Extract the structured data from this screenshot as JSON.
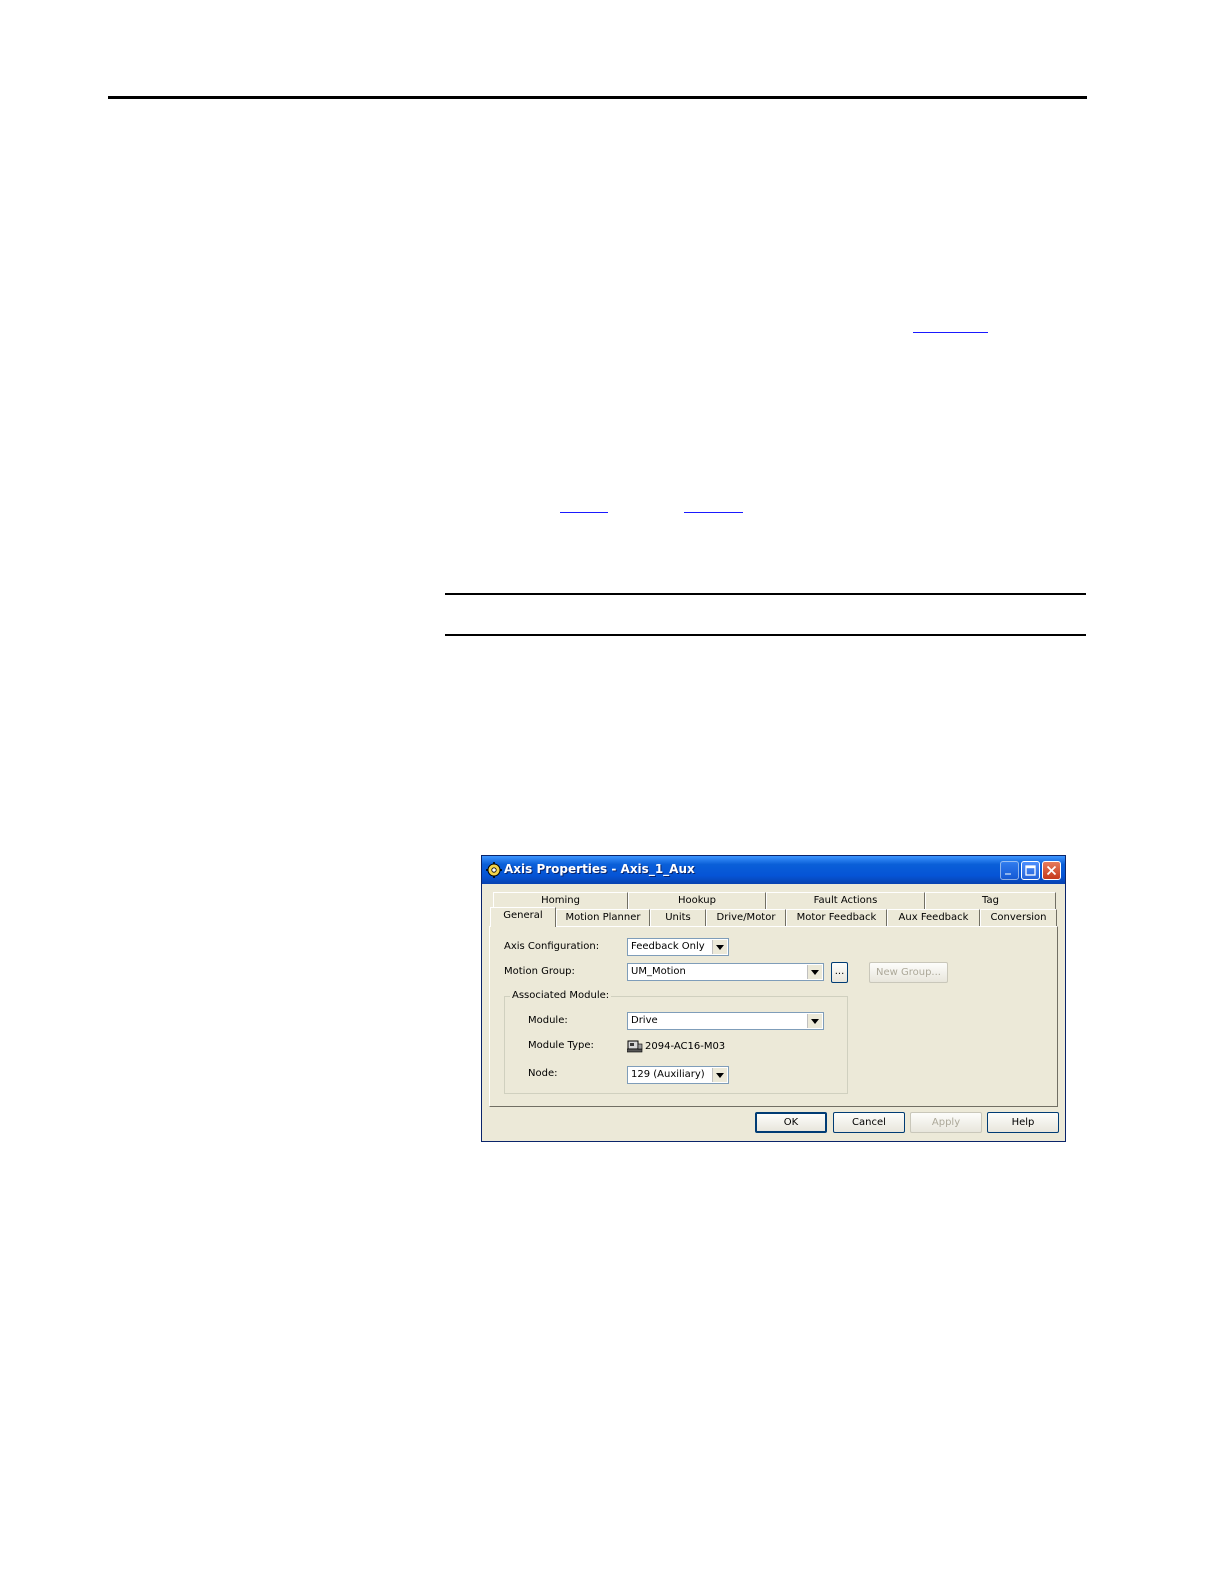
{
  "dialog": {
    "title": "Axis Properties - Axis_1_Aux",
    "tabs_back": [
      "Homing",
      "Hookup",
      "Fault Actions",
      "Tag"
    ],
    "tabs_front": [
      "General",
      "Motion Planner",
      "Units",
      "Drive/Motor",
      "Motor Feedback",
      "Aux Feedback",
      "Conversion"
    ],
    "active_tab": "General",
    "fields": {
      "axis_configuration_label": "Axis Configuration:",
      "axis_configuration_value": "Feedback Only",
      "motion_group_label": "Motion Group:",
      "motion_group_value": "UM_Motion",
      "browse_label": "...",
      "new_group_label": "New Group..."
    },
    "associated_module": {
      "group_label": "Associated Module:",
      "module_label": "Module:",
      "module_value": "Drive",
      "module_type_label": "Module Type:",
      "module_type_value": "2094-AC16-M03",
      "node_label": "Node:",
      "node_value": "129 (Auxiliary)"
    },
    "buttons": {
      "ok": "OK",
      "cancel": "Cancel",
      "apply": "Apply",
      "help": "Help"
    }
  }
}
